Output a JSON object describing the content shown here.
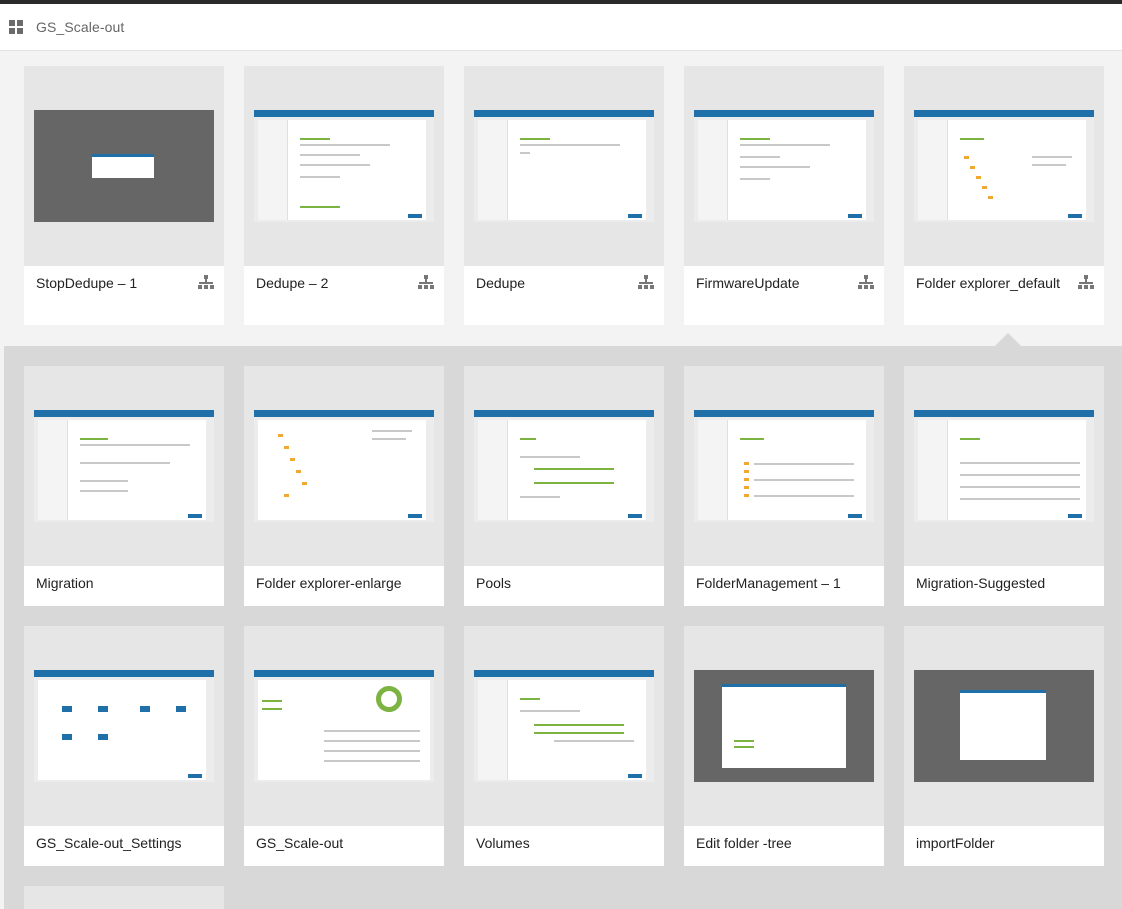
{
  "header": {
    "title": "GS_Scale-out",
    "icon": "grid-icon"
  },
  "cards": [
    {
      "label": "StopDedupe – 1",
      "icon": "flow-icon"
    },
    {
      "label": "Dedupe – 2",
      "icon": "flow-icon"
    },
    {
      "label": "Dedupe",
      "icon": "flow-icon"
    },
    {
      "label": "FirmwareUpdate",
      "icon": "flow-icon"
    },
    {
      "label": "Folder explorer_default",
      "icon": "flow-icon"
    },
    {
      "label": "Migration"
    },
    {
      "label": "Folder explorer-enlarge"
    },
    {
      "label": "Pools"
    },
    {
      "label": "FolderManagement – 1"
    },
    {
      "label": "Migration-Suggested"
    },
    {
      "label": "GS_Scale-out_Settings"
    },
    {
      "label": "GS_Scale-out"
    },
    {
      "label": "Volumes"
    },
    {
      "label": "Edit folder -tree"
    },
    {
      "label": "importFolder"
    }
  ],
  "colors": {
    "accent": "#1f6fa8",
    "green": "#7cb342",
    "folder": "#f0a830"
  }
}
